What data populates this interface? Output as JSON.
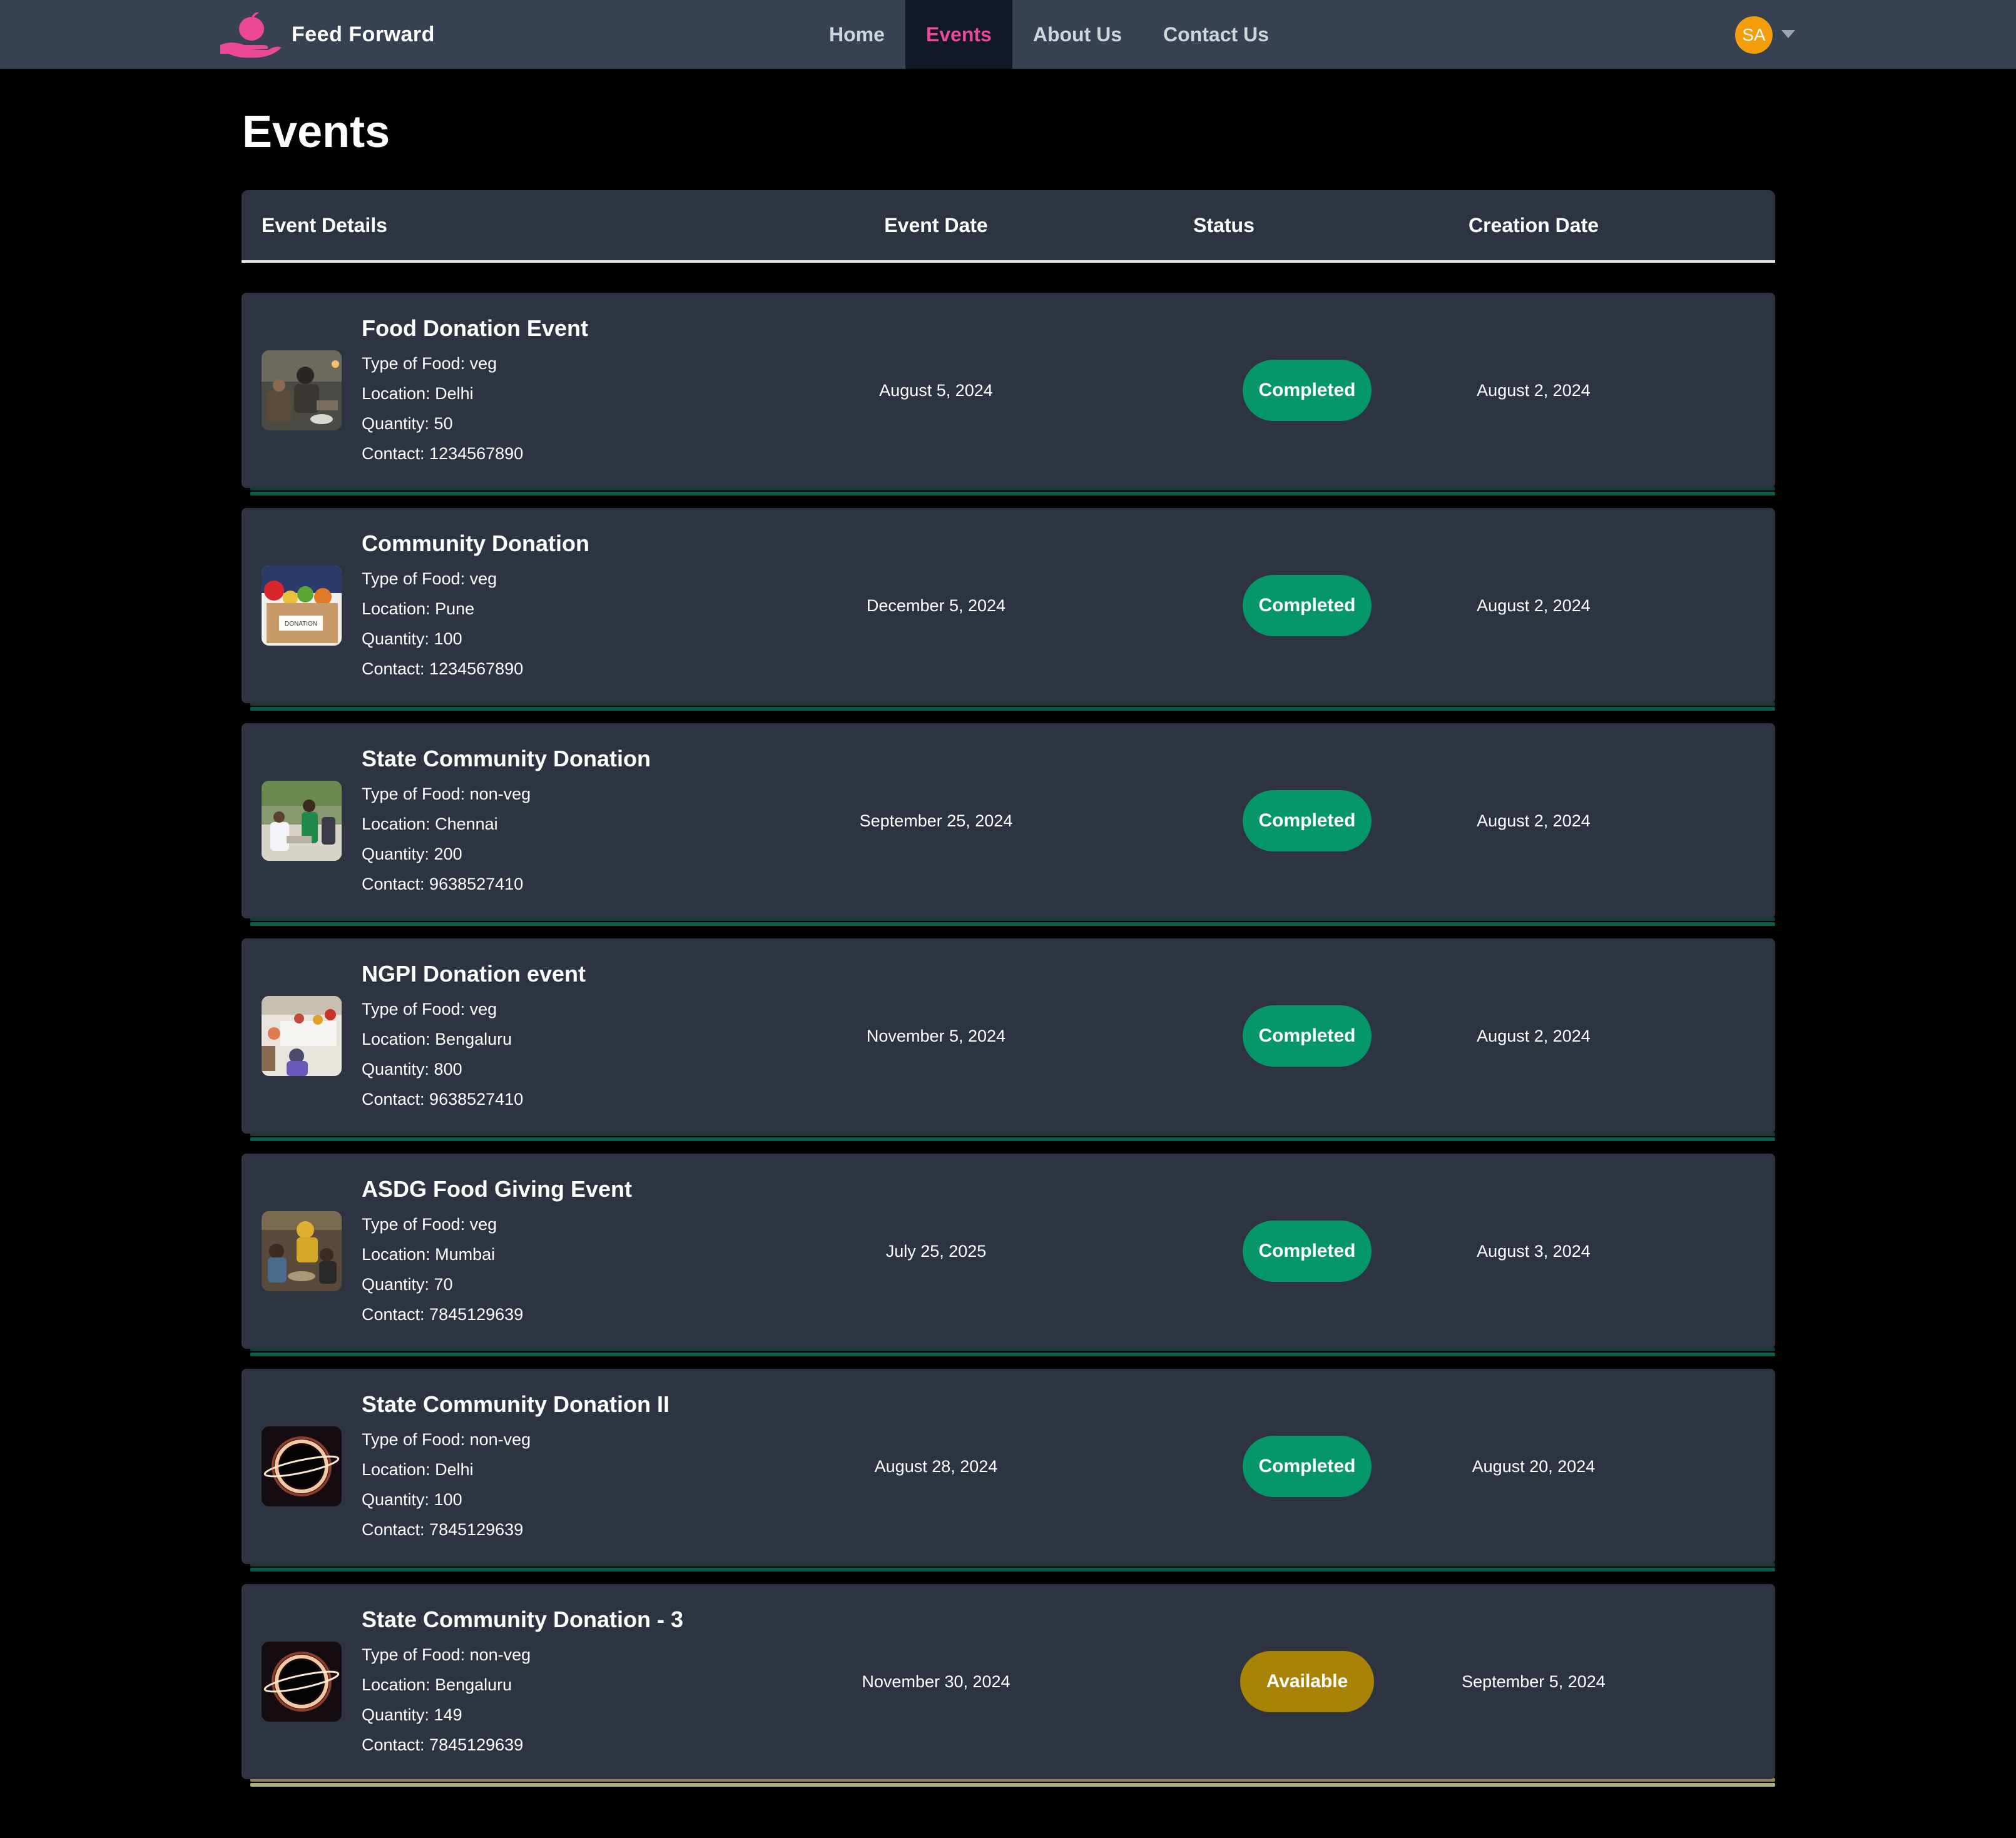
{
  "nav": {
    "brand": "Feed Forward",
    "links": [
      {
        "label": "Home"
      },
      {
        "label": "Events"
      },
      {
        "label": "About Us"
      },
      {
        "label": "Contact Us"
      }
    ],
    "active_index": 1,
    "avatar_initials": "SA",
    "icons": {
      "logo": "apple-on-hand-logo",
      "dropdown": "caret-down-icon"
    }
  },
  "page_title": "Events",
  "table": {
    "headers": [
      "Event Details",
      "Event Date",
      "Status",
      "Creation Date"
    ]
  },
  "colors": {
    "nav_bg": "#374151",
    "active_link": "#ec4899",
    "card_bg": "#2d3340",
    "completed": "#059669",
    "available": "#a98305",
    "avatar": "#f59e0b"
  },
  "events": [
    {
      "title": "Food Donation Event",
      "food_type": "Type of Food: veg",
      "location": "Location: Delhi",
      "quantity": "Quantity: 50",
      "contact": "Contact: 1234567890",
      "event_date": "August 5, 2024",
      "status": "Completed",
      "creation_date": "August 2, 2024",
      "thumbnail": "people-serving-food-photo"
    },
    {
      "title": "Community Donation",
      "food_type": "Type of Food: veg",
      "location": "Location: Pune",
      "quantity": "Quantity: 100",
      "contact": "Contact: 1234567890",
      "event_date": "December 5, 2024",
      "status": "Completed",
      "creation_date": "August 2, 2024",
      "thumbnail": "donation-box-photo",
      "thumbnail_text": "DONATION"
    },
    {
      "title": "State Community Donation",
      "food_type": "Type of Food: non-veg",
      "location": "Location: Chennai",
      "quantity": "Quantity: 200",
      "contact": "Contact: 9638527410",
      "event_date": "September 25, 2024",
      "status": "Completed",
      "creation_date": "August 2, 2024",
      "thumbnail": "volunteer-outdoors-photo"
    },
    {
      "title": "NGPI Donation event",
      "food_type": "Type of Food: veg",
      "location": "Location: Bengaluru",
      "quantity": "Quantity: 800",
      "contact": "Contact: 9638527410",
      "event_date": "November 5, 2024",
      "status": "Completed",
      "creation_date": "August 2, 2024",
      "thumbnail": "community-meal-photo"
    },
    {
      "title": "ASDG Food Giving Event",
      "food_type": "Type of Food: veg",
      "location": "Location: Mumbai",
      "quantity": "Quantity: 70",
      "contact": "Contact: 7845129639",
      "event_date": "July 25, 2025",
      "status": "Completed",
      "creation_date": "August 3, 2024",
      "thumbnail": "children-eating-photo"
    },
    {
      "title": "State Community Donation II",
      "food_type": "Type of Food: non-veg",
      "location": "Location: Delhi",
      "quantity": "Quantity: 100",
      "contact": "Contact: 7845129639",
      "event_date": "August 28, 2024",
      "status": "Completed",
      "creation_date": "August 20, 2024",
      "thumbnail": "eclipse-ring-image"
    },
    {
      "title": "State Community Donation - 3",
      "food_type": "Type of Food: non-veg",
      "location": "Location: Bengaluru",
      "quantity": "Quantity: 149",
      "contact": "Contact: 7845129639",
      "event_date": "November 30, 2024",
      "status": "Available",
      "creation_date": "September 5, 2024",
      "thumbnail": "eclipse-ring-image"
    }
  ]
}
